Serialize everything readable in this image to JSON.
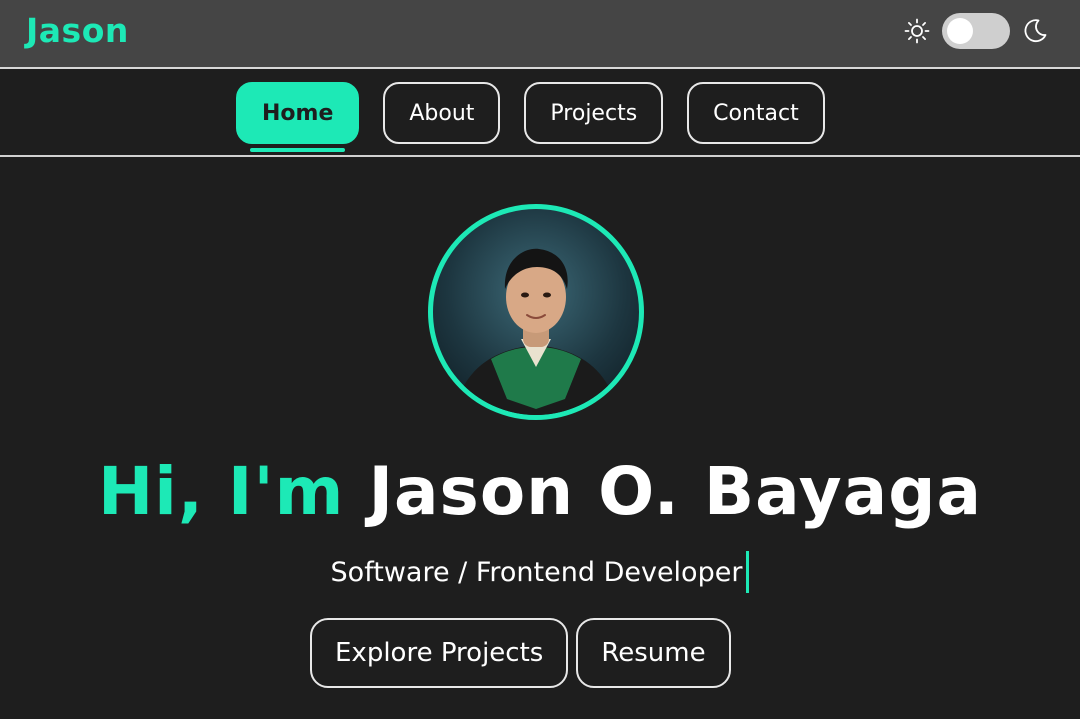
{
  "header": {
    "brand": "Jason",
    "theme_toggle": {
      "light_icon": "sun-icon",
      "dark_icon": "moon-icon",
      "state": "light"
    }
  },
  "nav": {
    "items": [
      {
        "label": "Home",
        "active": true
      },
      {
        "label": "About",
        "active": false
      },
      {
        "label": "Projects",
        "active": false
      },
      {
        "label": "Contact",
        "active": false
      }
    ]
  },
  "hero": {
    "greeting": "Hi, I'm",
    "name": "Jason O. Bayaga",
    "role": "Software / Frontend Developer",
    "buttons": {
      "explore": "Explore Projects",
      "resume": "Resume"
    }
  },
  "colors": {
    "accent": "#1de9b6",
    "background": "#1e1e1e",
    "topbar": "#454545",
    "text": "#ffffff"
  }
}
